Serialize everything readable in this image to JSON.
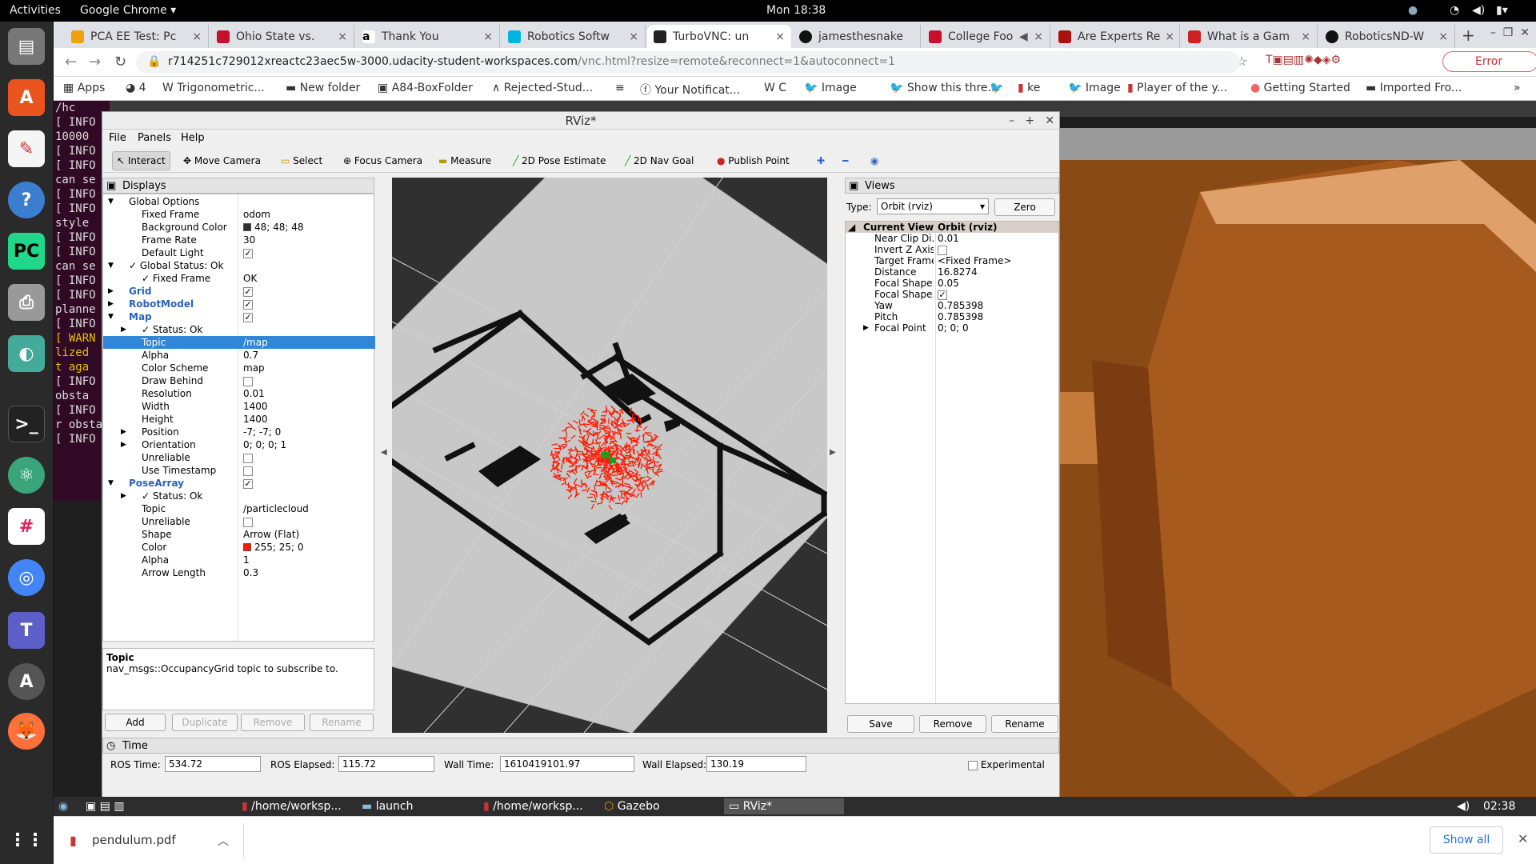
{
  "topbar": {
    "activities": "Activities",
    "app": "Google Chrome",
    "clock": "Mon 18:38"
  },
  "dock": {
    "items": [
      "files-icon",
      "app-center-icon",
      "text-editor-icon",
      "help-icon",
      "pycharm-icon",
      "printer-icon",
      "image-viewer-icon",
      "terminal-icon",
      "atom-icon",
      "slack-icon",
      "chrome-icon",
      "teams-icon",
      "software-updater-icon",
      "firefox-icon",
      "show-apps-icon"
    ]
  },
  "tabs": [
    {
      "label": "PCA EE Test: Pc",
      "color": "#f0a010"
    },
    {
      "label": "Ohio State vs.",
      "color": "#c8102e"
    },
    {
      "label": "Thank You",
      "color": "#222222"
    },
    {
      "label": "Robotics Softw",
      "color": "#02b3e4"
    },
    {
      "label": "TurboVNC: un",
      "color": "#222222"
    },
    {
      "label": "jamesthesnake",
      "color": "#111111"
    },
    {
      "label": "College Foo",
      "color": "#c8102e"
    },
    {
      "label": "Are Experts Re",
      "color": "#aa1111"
    },
    {
      "label": "What is a Gam",
      "color": "#cc2222"
    },
    {
      "label": "RoboticsND-W",
      "color": "#111111"
    }
  ],
  "omnibox": {
    "url_host": "r714251c729012xreactc23aec5w-3000.udacity-student-workspaces.com",
    "url_path": "/vnc.html?resize=remote&reconnect=1&autoconnect=1",
    "profile_status": "Error"
  },
  "bookmarks": [
    "Apps",
    "4",
    "Trigonometric...",
    "New folder",
    "A84-BoxFolder",
    "Rejected-Stud...",
    "Your Notificat...",
    "C",
    "Image",
    "Show this thre...",
    "ke",
    "Image",
    "Player of the y...",
    "Getting Started",
    "Imported Fro..."
  ],
  "terminal": {
    "lines": [
      "/hc",
      "",
      "[ INFO",
      "10000",
      "[ INFO",
      "[ INFO",
      "can se",
      "[ INFO",
      "[ INFO",
      "style",
      "[ INFO",
      "[ INFO",
      "can se",
      "[ INFO",
      "[ INFO",
      "planne",
      "[ INFO",
      "[ WARN",
      "lized",
      "t aga",
      "[ INFO",
      "obsta",
      "[ INFO",
      "r obsta",
      "[ INFO"
    ]
  },
  "rviz": {
    "title": "RViz*",
    "menu": [
      "File",
      "Panels",
      "Help"
    ],
    "tools": [
      "Interact",
      "Move Camera",
      "Select",
      "Focus Camera",
      "Measure",
      "2D Pose Estimate",
      "2D Nav Goal",
      "Publish Point"
    ],
    "displays_title": "Displays",
    "properties": [
      {
        "indent": 0,
        "arrow": "down",
        "name": "Global Options",
        "value": "",
        "style": "plain"
      },
      {
        "indent": 1,
        "name": "Fixed Frame",
        "value": "odom"
      },
      {
        "indent": 1,
        "name": "Background Color",
        "value": "48; 48; 48",
        "swatch": "#303030"
      },
      {
        "indent": 1,
        "name": "Frame Rate",
        "value": "30"
      },
      {
        "indent": 1,
        "name": "Default Light",
        "value": "",
        "check": "✓"
      },
      {
        "indent": 0,
        "arrow": "down",
        "name": "✓ Global Status: Ok",
        "value": ""
      },
      {
        "indent": 1,
        "name": "✓ Fixed Frame",
        "value": "OK"
      },
      {
        "indent": 0,
        "arrow": "right",
        "name": "Grid",
        "value": "",
        "check": "✓",
        "style": "link"
      },
      {
        "indent": 0,
        "arrow": "right",
        "name": "RobotModel",
        "value": "",
        "check": "✓",
        "style": "link"
      },
      {
        "indent": 0,
        "arrow": "down",
        "name": "Map",
        "value": "",
        "check": "✓",
        "style": "link"
      },
      {
        "indent": 1,
        "arrow": "right",
        "name": "✓ Status: Ok",
        "value": ""
      },
      {
        "indent": 1,
        "name": "Topic",
        "value": "/map",
        "selected": true
      },
      {
        "indent": 1,
        "name": "Alpha",
        "value": "0.7"
      },
      {
        "indent": 1,
        "name": "Color Scheme",
        "value": "map"
      },
      {
        "indent": 1,
        "name": "Draw Behind",
        "value": "",
        "check": ""
      },
      {
        "indent": 1,
        "name": "Resolution",
        "value": "0.01"
      },
      {
        "indent": 1,
        "name": "Width",
        "value": "1400"
      },
      {
        "indent": 1,
        "name": "Height",
        "value": "1400"
      },
      {
        "indent": 1,
        "arrow": "right",
        "name": "Position",
        "value": "-7; -7; 0"
      },
      {
        "indent": 1,
        "arrow": "right",
        "name": "Orientation",
        "value": "0; 0; 0; 1"
      },
      {
        "indent": 1,
        "name": "Unreliable",
        "value": "",
        "check": ""
      },
      {
        "indent": 1,
        "name": "Use Timestamp",
        "value": "",
        "check": ""
      },
      {
        "indent": 0,
        "arrow": "down",
        "name": "PoseArray",
        "value": "",
        "check": "✓",
        "style": "link"
      },
      {
        "indent": 1,
        "arrow": "right",
        "name": "✓ Status: Ok",
        "value": ""
      },
      {
        "indent": 1,
        "name": "Topic",
        "value": "/particlecloud"
      },
      {
        "indent": 1,
        "name": "Unreliable",
        "value": "",
        "check": ""
      },
      {
        "indent": 1,
        "name": "Shape",
        "value": "Arrow (Flat)"
      },
      {
        "indent": 1,
        "name": "Color",
        "value": "255; 25; 0",
        "swatch": "#ff1900"
      },
      {
        "indent": 1,
        "name": "Alpha",
        "value": "1"
      },
      {
        "indent": 1,
        "name": "Arrow Length",
        "value": "0.3"
      }
    ],
    "help_title": "Topic",
    "help_text": "nav_msgs::OccupancyGrid topic to subscribe to.",
    "display_buttons": [
      "Add",
      "Duplicate",
      "Remove",
      "Rename"
    ],
    "views": {
      "title": "Views",
      "type_label": "Type:",
      "type_value": "Orbit (rviz)",
      "zero": "Zero",
      "header": [
        "Current View",
        "Orbit (rviz)"
      ],
      "rows": [
        [
          "Near Clip Di...",
          "0.01"
        ],
        [
          "Invert Z Axis",
          ""
        ],
        [
          "Target Frame",
          "<Fixed Frame>"
        ],
        [
          "Distance",
          "16.8274"
        ],
        [
          "Focal Shape...",
          "0.05"
        ],
        [
          "Focal Shape...",
          "✓"
        ],
        [
          "Yaw",
          "0.785398"
        ],
        [
          "Pitch",
          "0.785398"
        ],
        [
          "Focal Point",
          "0; 0; 0"
        ]
      ],
      "buttons": [
        "Save",
        "Remove",
        "Rename"
      ]
    },
    "time": {
      "title": "Time",
      "ros_time_label": "ROS Time:",
      "ros_time": "534.72",
      "ros_elapsed_label": "ROS Elapsed:",
      "ros_elapsed": "115.72",
      "wall_time_label": "Wall Time:",
      "wall_time": "1610419101.97",
      "wall_elapsed_label": "Wall Elapsed:",
      "wall_elapsed": "130.19",
      "experimental": "Experimental"
    }
  },
  "taskbar": {
    "tasks": [
      "/home/worksp...",
      "launch",
      "/home/worksp...",
      "Gazebo",
      "RViz*"
    ],
    "clock": "02:38"
  },
  "download": {
    "file": "pendulum.pdf",
    "show_all": "Show all"
  }
}
